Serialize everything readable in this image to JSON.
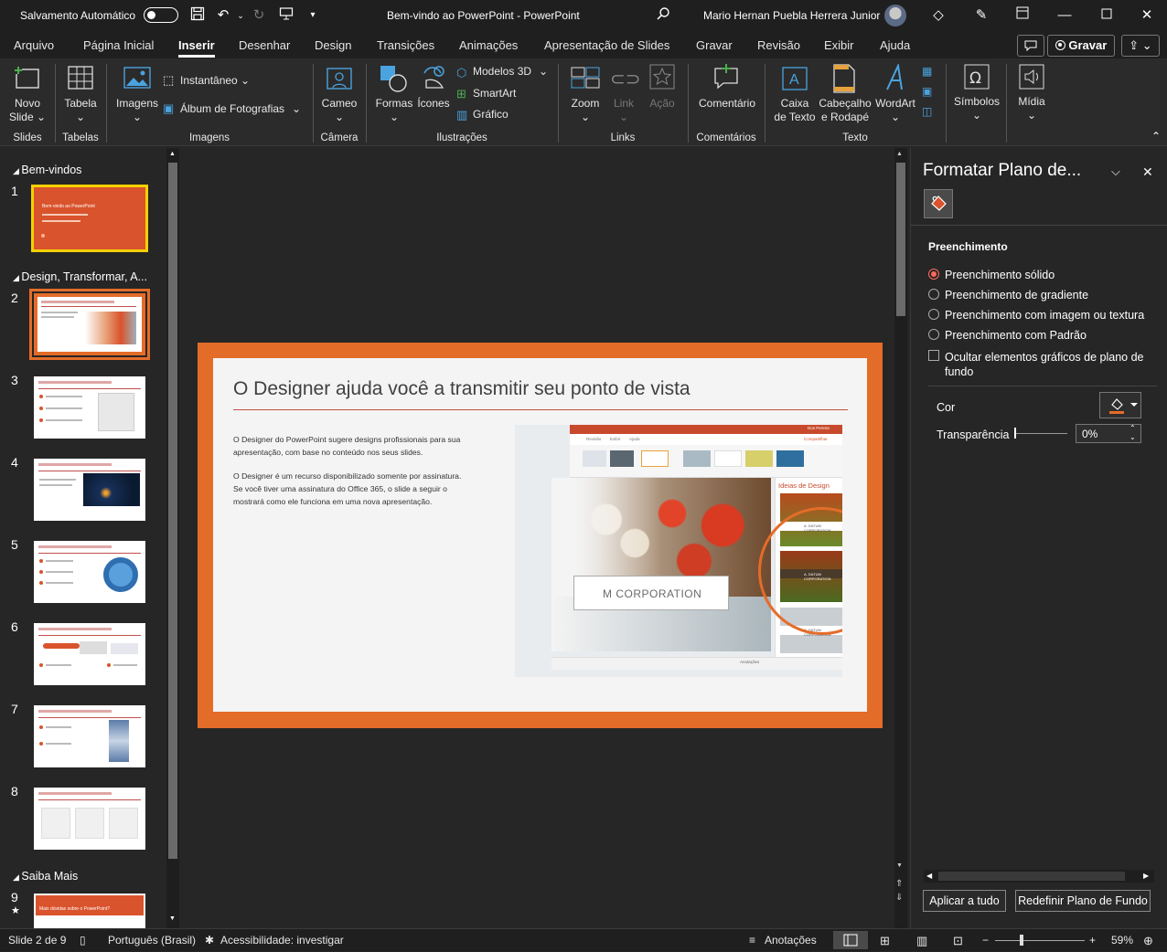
{
  "titlebar": {
    "autosave_label": "Salvamento Automático",
    "doc_title": "Bem-vindo ao PowerPoint  -  PowerPoint",
    "user_name": "Mario Hernan Puebla Herrera Junior"
  },
  "tabs": [
    "Arquivo",
    "Página Inicial",
    "Inserir",
    "Desenhar",
    "Design",
    "Transições",
    "Animações",
    "Apresentação de Slides",
    "Gravar",
    "Revisão",
    "Exibir",
    "Ajuda"
  ],
  "top_buttons": {
    "record": "Gravar"
  },
  "ribbon": {
    "new_slide": [
      "Novo",
      "Slide ⌄"
    ],
    "table": "Tabela",
    "images": "Imagens",
    "screenshot": "Instantâneo ⌄",
    "photo_album": "Álbum de Fotografias",
    "cameo": "Cameo",
    "shapes": "Formas",
    "icons": "Ícones",
    "models3d": "Modelos 3D",
    "smartart": "SmartArt",
    "chart": "Gráfico",
    "zoom": "Zoom",
    "link": "Link",
    "action": "Ação",
    "comment": "Comentário",
    "textbox": [
      "Caixa",
      "de Texto"
    ],
    "header_footer": [
      "Cabeçalho",
      "e Rodapé"
    ],
    "wordart": "WordArt",
    "symbols": "Símbolos",
    "media": "Mídia",
    "groups": {
      "slides": "Slides",
      "tables": "Tabelas",
      "images": "Imagens",
      "camera": "Câmera",
      "illustrations": "Ilustrações",
      "links": "Links",
      "comments": "Comentários",
      "text": "Texto"
    }
  },
  "thumbnails": {
    "sections": [
      "Bem-vindos",
      "Design, Transformar, A...",
      "Saiba Mais"
    ],
    "slide_numbers": [
      "1",
      "2",
      "3",
      "4",
      "5",
      "6",
      "7",
      "8",
      "9"
    ],
    "slide1_title": "Bem-vindo ao PowerPoint",
    "slide9_title": "Mais dúvidas sobre o PowerPoint?"
  },
  "slide": {
    "title": "O Designer ajuda você a transmitir seu ponto de vista",
    "para1": "O Designer do PowerPoint sugere designs profissionais para sua apresentação, com base no conteúdo nos seus slides.",
    "para2": "O Designer é um recurso disponibilizado somente por assinatura. Se você tiver uma assinatura do Office 365, o slide a seguir o mostrará como ele funciona em uma nova apresentação.",
    "inner_title": "M CORPORATION",
    "inner_side_title": "Ideias de Design",
    "inner_card": "A. DATUM CORPORATION",
    "inner_tabs": [
      "Revisão",
      "Exibir",
      "Ajuda"
    ],
    "inner_share": "Compartilhar",
    "inner_user": "Dos Pereira",
    "inner_bottom": "Anotações"
  },
  "pane": {
    "title": "Formatar Plano de...",
    "section": "Preenchimento",
    "options": [
      "Preenchimento sólido",
      "Preenchimento de gradiente",
      "Preenchimento com imagem ou textura",
      "Preenchimento com Padrão"
    ],
    "hide_bg_graphics": [
      "Ocultar elementos gráficos de plano de",
      "fundo"
    ],
    "color_label": "Cor",
    "transparency_label": "Transparência",
    "transparency_value": "0%",
    "apply_all": "Aplicar a tudo",
    "reset_bg": "Redefinir Plano de Fundo"
  },
  "status": {
    "slide_count": "Slide 2 de 9",
    "language": "Português (Brasil)",
    "accessibility": "Acessibilidade: investigar",
    "notes": "Anotações",
    "zoom": "59%"
  },
  "colors": {
    "accent": "#e46c29",
    "slide_title_rule": "#c0504d",
    "radio_on": "#ff6a5a",
    "selected_thumb_border": "#f5d000"
  }
}
